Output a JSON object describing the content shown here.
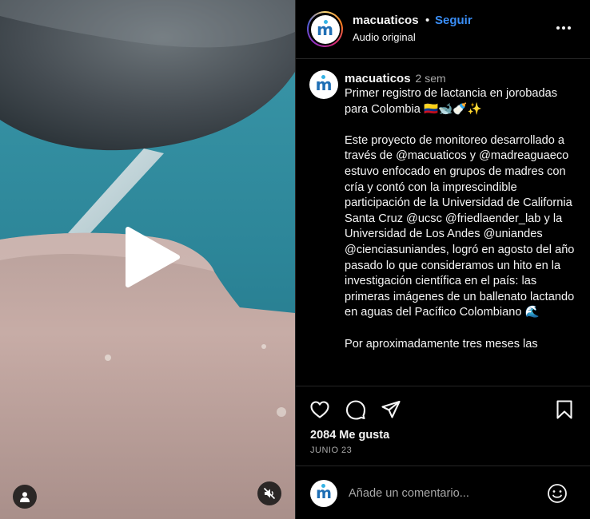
{
  "post": {
    "username": "macuaticos",
    "separator": "•",
    "follow_label": "Seguir",
    "audio_label": "Audio original",
    "avatar_letter": "m",
    "caption": {
      "username": "macuaticos",
      "time": "2 sem",
      "text": "Primer registro de lactancia en jorobadas para Colombia 🇨🇴🐋🍼✨\n\nEste proyecto de monitoreo desarrollado a través de @macuaticos y @madreaguaeco estuvo enfocado en grupos de madres con cría y contó con la imprescindible participación de la Universidad de California Santa Cruz @ucsc @friedlaender_lab y la Universidad de Los Andes @uniandes @cienciasuniandes, logró en agosto del año pasado lo que consideramos un hito en la investigación científica en el país: las primeras imágenes de un ballenato lactando en aguas del Pacífico Colombiano 🌊\n\nPor aproximadamente tres meses las"
    },
    "likes": "2084 Me gusta",
    "date": "JUNIO 23",
    "comment_placeholder": "Añade un comentario..."
  },
  "icons": {
    "heart": "heart-icon",
    "comment": "comment-icon",
    "share": "share-icon",
    "save": "bookmark-icon",
    "more": "more-icon",
    "play": "play-icon",
    "tag": "user-tag-icon",
    "mute": "muted-speaker-icon",
    "emoji": "emoji-icon"
  },
  "colors": {
    "follow": "#3a8ef6",
    "background": "#000000",
    "water": "#2a7f93",
    "border": "#262626"
  }
}
